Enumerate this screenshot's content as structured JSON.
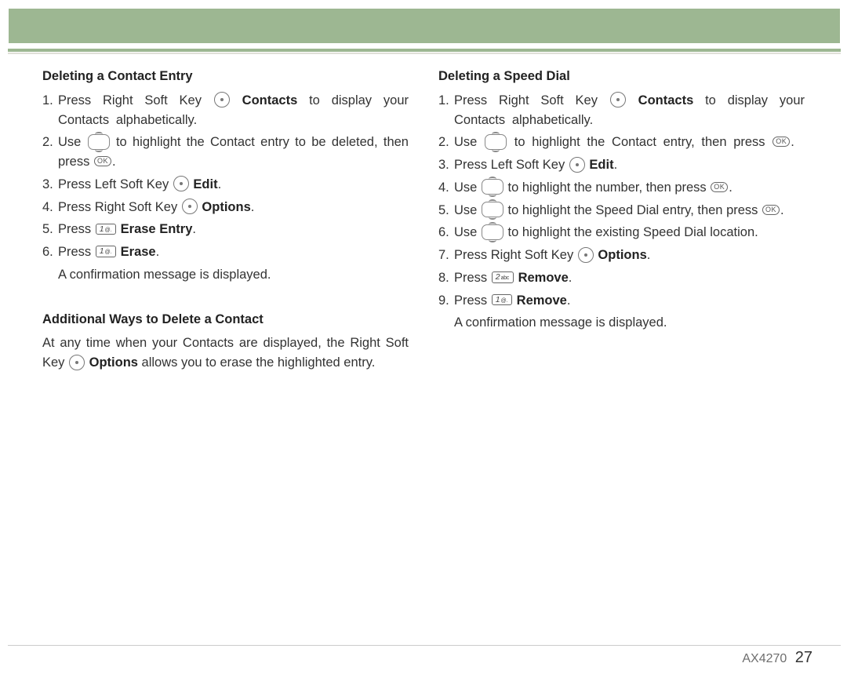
{
  "leftColumn": {
    "section1": {
      "heading": "Deleting a Contact Entry",
      "steps": [
        {
          "n": "1.",
          "parts": [
            "Press Right Soft Key ",
            "{softkey}",
            " ",
            {
              "b": "Contacts"
            },
            " to display your Contacts alphabetically."
          ],
          "loose": true
        },
        {
          "n": "2.",
          "parts": [
            "Use ",
            "{nav}",
            " to highlight the Contact entry to be deleted, then press ",
            "{ok}",
            "."
          ]
        },
        {
          "n": "3.",
          "parts": [
            "Press Left Soft Key ",
            "{softkey}",
            " ",
            {
              "b": "Edit"
            },
            "."
          ]
        },
        {
          "n": "4.",
          "parts": [
            "Press Right Soft Key ",
            "{softkey}",
            " ",
            {
              "b": "Options"
            },
            "."
          ]
        },
        {
          "n": "5.",
          "parts": [
            "Press ",
            "{k1}",
            " ",
            {
              "b": "Erase Entry"
            },
            "."
          ]
        },
        {
          "n": "6.",
          "parts": [
            "Press ",
            "{k1}",
            " ",
            {
              "b": "Erase"
            },
            "."
          ]
        }
      ],
      "after": "A confirmation message is displayed."
    },
    "section2": {
      "heading": "Additional Ways to Delete a Contact",
      "paraParts": [
        "At any time when your Contacts are displayed, the Right Soft Key ",
        "{softkey}",
        " ",
        {
          "b": "Options"
        },
        " allows you to erase the highlighted entry."
      ]
    }
  },
  "rightColumn": {
    "section1": {
      "heading": "Deleting a Speed Dial",
      "steps": [
        {
          "n": "1.",
          "parts": [
            "Press Right Soft Key ",
            "{softkey}",
            " ",
            {
              "b": "Contacts"
            },
            " to display your Contacts alphabetically."
          ],
          "loose": true
        },
        {
          "n": "2.",
          "parts": [
            "Use ",
            "{nav}",
            " to highlight the Contact entry, then press ",
            "{ok}",
            "."
          ],
          "loose": true
        },
        {
          "n": "3.",
          "parts": [
            "Press Left Soft Key ",
            "{softkey}",
            " ",
            {
              "b": "Edit"
            },
            "."
          ]
        },
        {
          "n": "4.",
          "parts": [
            "Use ",
            "{nav}",
            " to highlight the number, then press ",
            "{ok}",
            "."
          ]
        },
        {
          "n": "5.",
          "parts": [
            "Use ",
            "{nav}",
            " to highlight the Speed Dial entry, then press ",
            "{ok}",
            "."
          ]
        },
        {
          "n": "6.",
          "parts": [
            "Use ",
            "{nav}",
            " to highlight the existing Speed Dial location."
          ]
        },
        {
          "n": "7.",
          "parts": [
            "Press Right Soft Key ",
            "{softkey}",
            " ",
            {
              "b": "Options"
            },
            "."
          ]
        },
        {
          "n": "8.",
          "parts": [
            "Press ",
            "{k2}",
            " ",
            {
              "b": "Remove"
            },
            "."
          ]
        },
        {
          "n": "9.",
          "parts": [
            "Press ",
            "{k1}",
            " ",
            {
              "b": "Remove"
            },
            "."
          ]
        }
      ],
      "after": "A confirmation message is displayed."
    }
  },
  "footer": {
    "model": "AX4270",
    "page": "27"
  }
}
